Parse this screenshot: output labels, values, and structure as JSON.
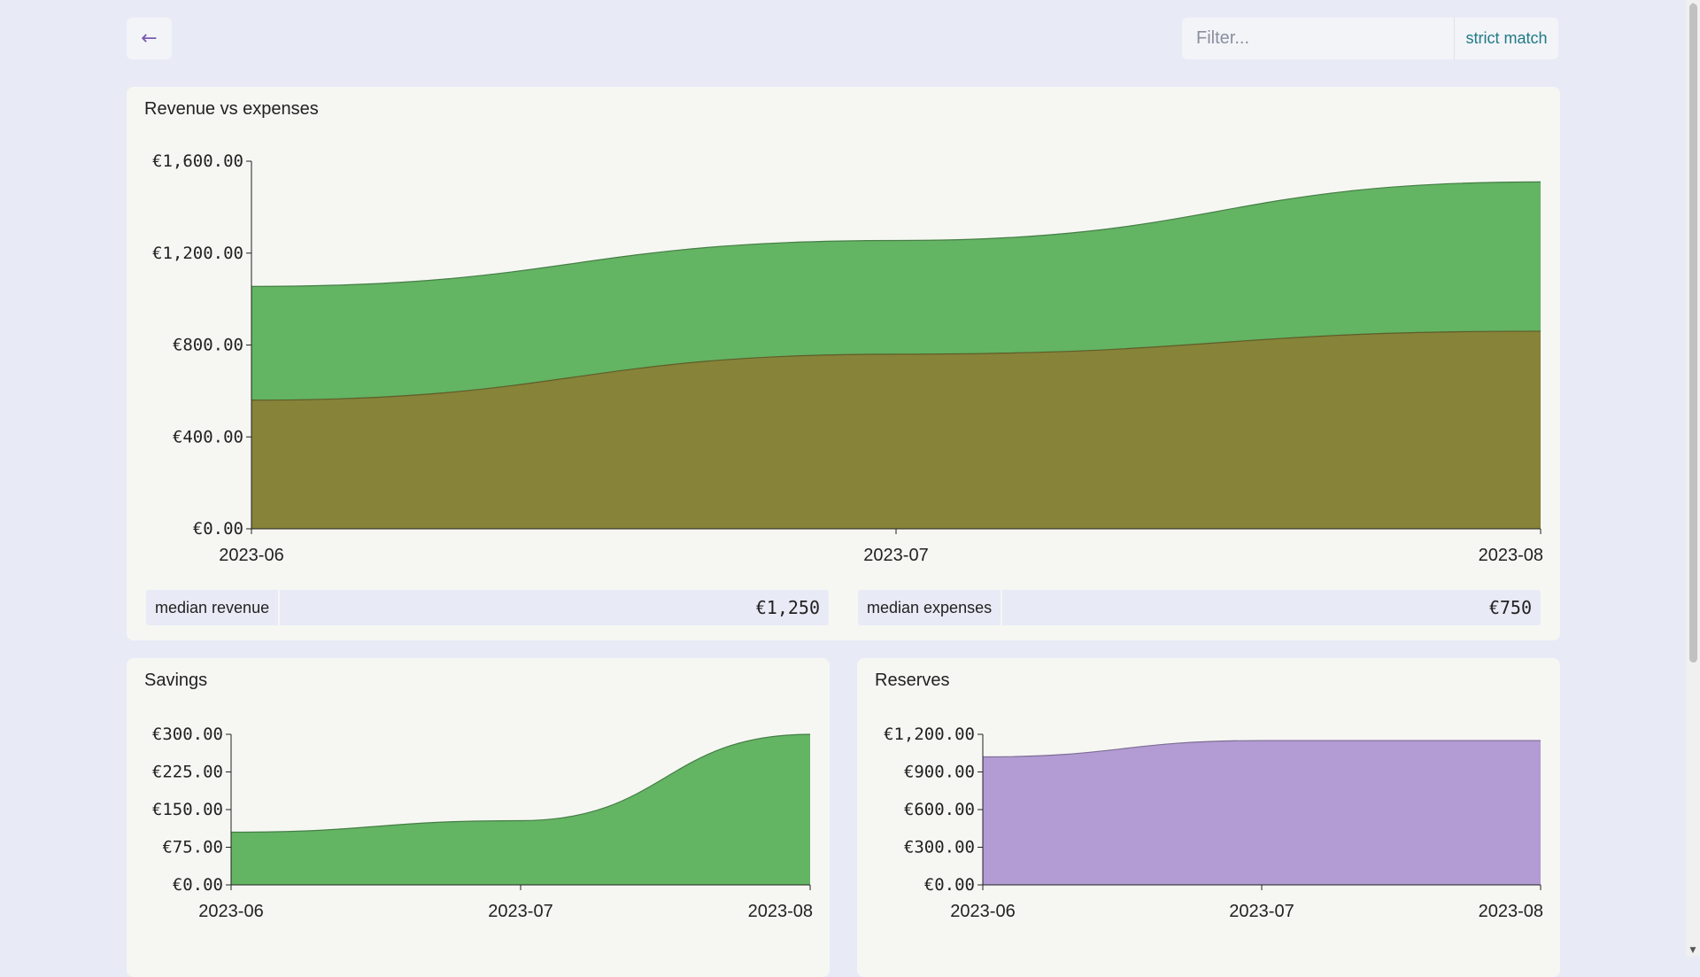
{
  "toolbar": {
    "back_label": "←",
    "filter_placeholder": "Filter...",
    "filter_value": "",
    "strict_label": "strict match"
  },
  "colors": {
    "revenue": "#63b463",
    "expenses": "#878339",
    "savings": "#63b463",
    "reserves": "#b39bd4",
    "reserves_line": "#7a5ab0"
  },
  "chart_data": [
    {
      "type": "area",
      "title": "Revenue vs expenses",
      "x": [
        "2023-06",
        "2023-07",
        "2023-08"
      ],
      "ylim": [
        0,
        1600
      ],
      "yticks": [
        "€0.00",
        "€400.00",
        "€800.00",
        "€1,200.00",
        "€1,600.00"
      ],
      "ytick_values": [
        0,
        400,
        800,
        1200,
        1600
      ],
      "series": [
        {
          "values": [
            1055,
            1255,
            1510
          ],
          "color": "#63b463"
        },
        {
          "values": [
            560,
            760,
            860
          ],
          "color": "#878339"
        }
      ],
      "stats": [
        {
          "label": "median revenue",
          "value": "€1,250"
        },
        {
          "label": "median expenses",
          "value": "€750"
        }
      ]
    },
    {
      "type": "area",
      "title": "Savings",
      "x": [
        "2023-06",
        "2023-07",
        "2023-08"
      ],
      "ylim": [
        0,
        300
      ],
      "yticks": [
        "€0.00",
        "€75.00",
        "€150.00",
        "€225.00",
        "€300.00"
      ],
      "ytick_values": [
        0,
        75,
        150,
        225,
        300
      ],
      "series": [
        {
          "values": [
            105,
            128,
            300
          ],
          "color": "#63b463"
        }
      ]
    },
    {
      "type": "area",
      "title": "Reserves",
      "x": [
        "2023-06",
        "2023-07",
        "2023-08"
      ],
      "ylim": [
        0,
        1200
      ],
      "yticks": [
        "€0.00",
        "€300.00",
        "€600.00",
        "€900.00",
        "€1,200.00"
      ],
      "ytick_values": [
        0,
        300,
        600,
        900,
        1200
      ],
      "series": [
        {
          "values": [
            1020,
            1150,
            1150
          ],
          "color": "#b39bd4"
        }
      ]
    }
  ]
}
